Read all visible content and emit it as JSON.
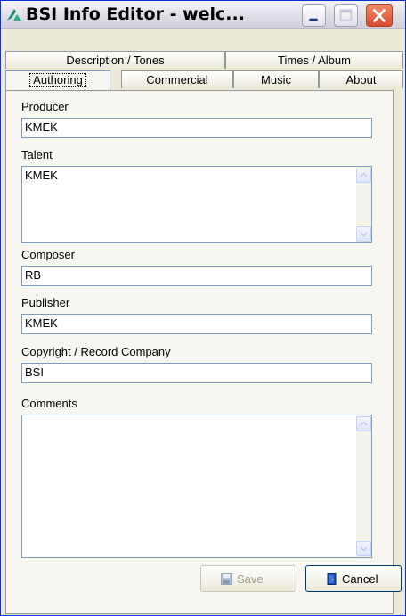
{
  "window": {
    "title": "BSI Info Editor - welc...",
    "icons": [
      "app-logo-icon",
      "minimize-icon",
      "maximize-icon",
      "close-icon"
    ]
  },
  "tabs": {
    "row_back": [
      {
        "label": "Description / Tones"
      },
      {
        "label": "Times / Album"
      }
    ],
    "row_front": [
      {
        "label": "Authoring",
        "selected": true
      },
      {
        "label": "Commercial"
      },
      {
        "label": "Music"
      },
      {
        "label": "About"
      }
    ]
  },
  "form": {
    "producer": {
      "label": "Producer",
      "value": "KMEK"
    },
    "talent": {
      "label": "Talent",
      "value": "KMEK"
    },
    "composer": {
      "label": "Composer",
      "value": "RB"
    },
    "publisher": {
      "label": "Publisher",
      "value": "KMEK"
    },
    "copyright": {
      "label": "Copyright / Record Company",
      "value": "BSI"
    },
    "comments": {
      "label": "Comments",
      "value": ""
    }
  },
  "buttons": {
    "save": {
      "label": "Save",
      "enabled": false,
      "icon": "floppy-disk-icon"
    },
    "cancel": {
      "label": "Cancel",
      "enabled": true,
      "icon": "exit-door-icon"
    }
  },
  "colors": {
    "titlebar": "#e2e2ea",
    "close_button": "#d94a2e",
    "field_border": "#7f9db9",
    "panel": "#f7f6f0"
  }
}
